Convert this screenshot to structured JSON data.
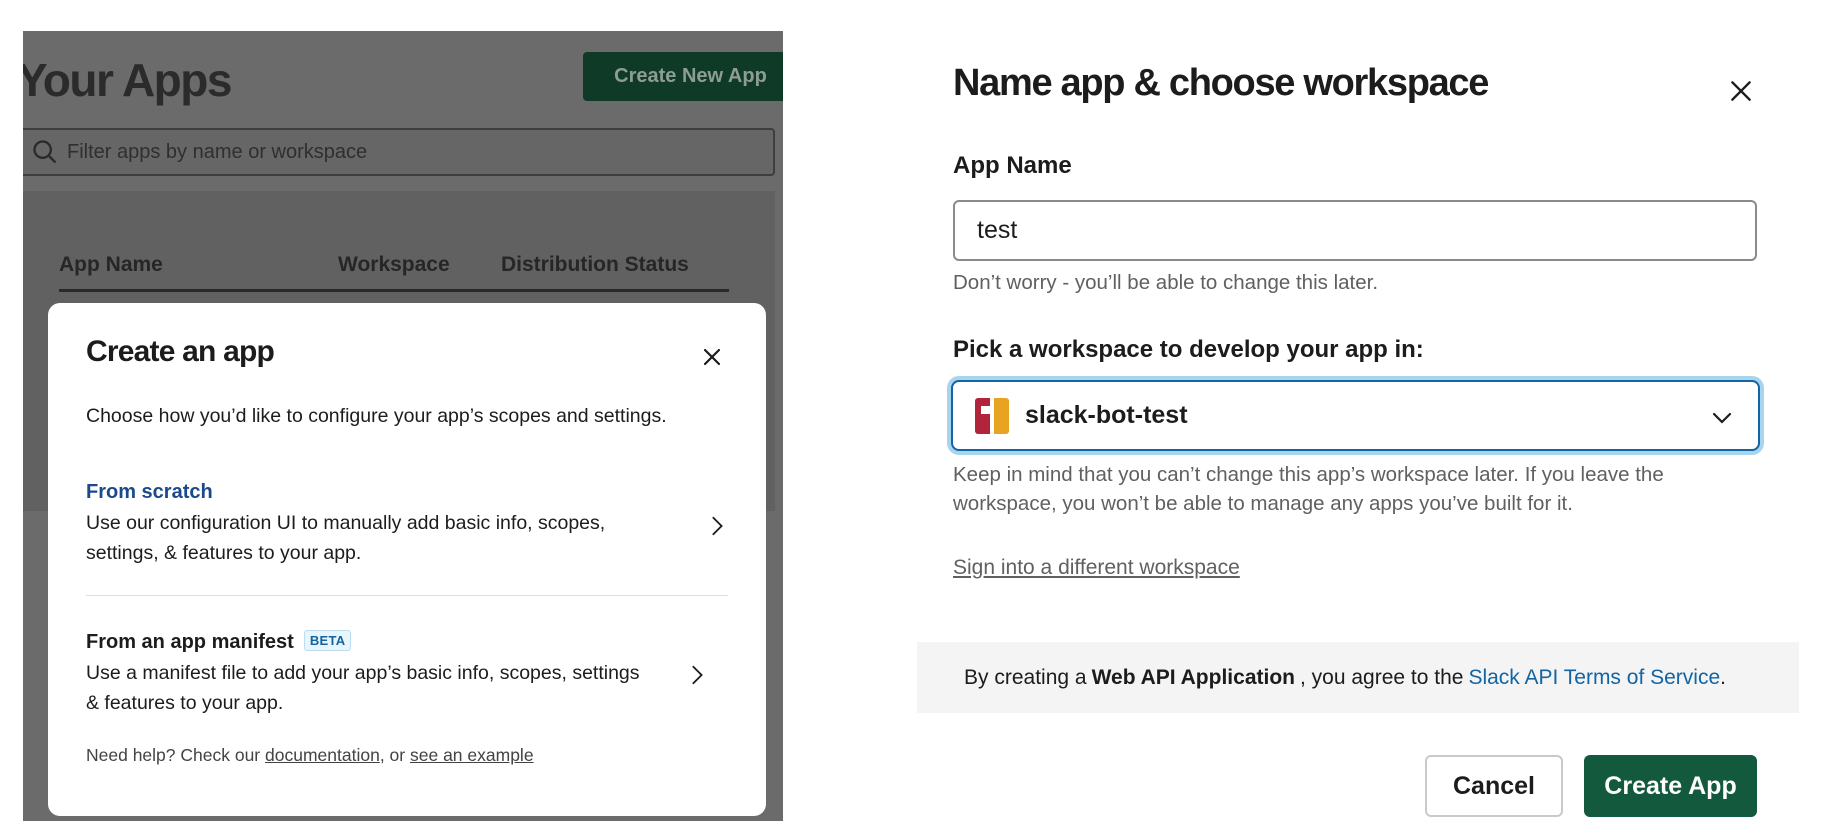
{
  "background_page": {
    "title": "Your Apps",
    "create_button": "Create New App",
    "filter_placeholder": "Filter apps by name or workspace",
    "columns": [
      "App Name",
      "Workspace",
      "Distribution Status"
    ]
  },
  "create_modal": {
    "title": "Create an app",
    "subtitle": "Choose how you’d like to configure your app’s scopes and settings.",
    "options": [
      {
        "title": "From scratch",
        "description": "Use our configuration UI to manually add basic info, scopes, settings, & features to your app."
      },
      {
        "title": "From an app manifest",
        "badge": "BETA",
        "description": "Use a manifest file to add your app’s basic info, scopes, settings & features to your app."
      }
    ],
    "help_prefix": "Need help? Check our",
    "help_link1": "documentation",
    "help_middle": ", or",
    "help_link2": "see an example"
  },
  "name_modal": {
    "title": "Name app & choose workspace",
    "app_name_label": "App Name",
    "app_name_value": "test",
    "app_name_hint": "Don’t worry - you’ll be able to change this later.",
    "workspace_label": "Pick a workspace to develop your app in:",
    "workspace_selected": "slack-bot-test",
    "workspace_hint": "Keep in mind that you can’t change this app’s workspace later. If you leave the workspace, you won’t be able to manage any apps you’ve built for it.",
    "sign_in_link": "Sign into a different workspace",
    "terms_prefix": "By creating a",
    "terms_bold": "Web API Application",
    "terms_middle": ", you agree to the",
    "terms_link": "Slack API Terms of Service",
    "terms_suffix": ".",
    "cancel_button": "Cancel",
    "create_button": "Create App"
  },
  "colors": {
    "primary_green": "#12593e",
    "link_blue": "#1264a3",
    "focus_ring": "#a8d4ee"
  },
  "icons": [
    "search-icon",
    "close-icon",
    "chevron-right-icon",
    "chevron-down-icon",
    "workspace-logo"
  ]
}
